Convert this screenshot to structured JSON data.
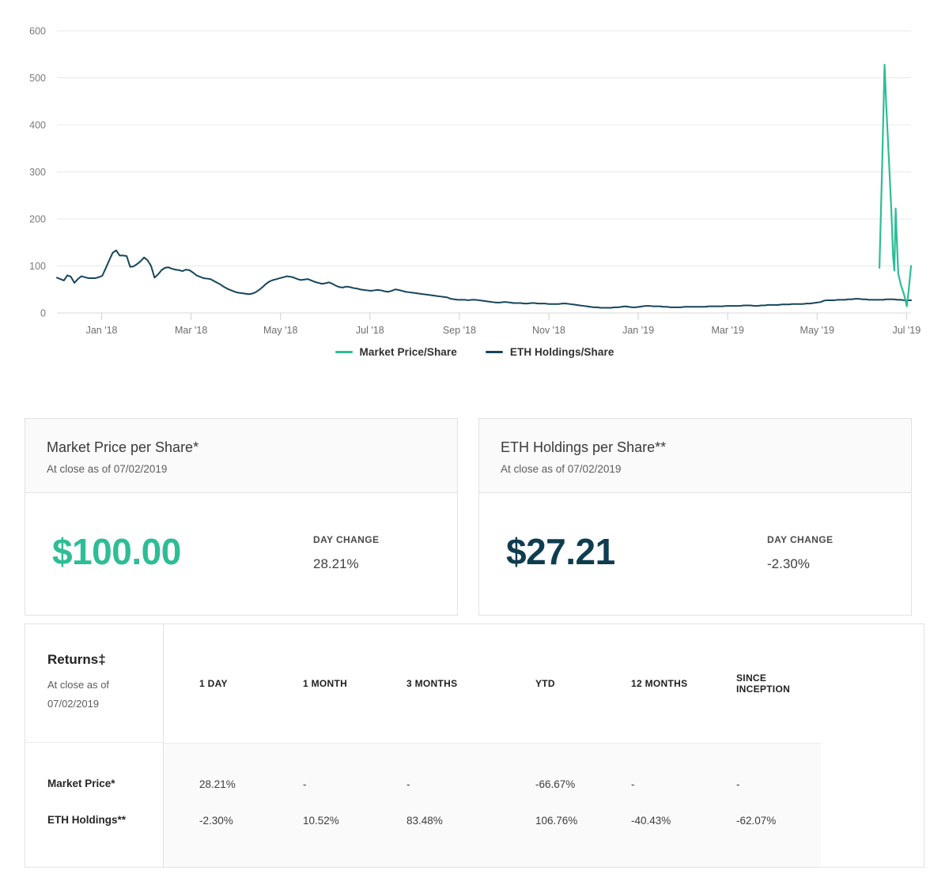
{
  "chart_data": {
    "type": "line",
    "title": "",
    "xlabel": "",
    "ylabel": "",
    "ylim": [
      0,
      600
    ],
    "yticks": [
      0,
      100,
      200,
      300,
      400,
      500,
      600
    ],
    "xtick_labels": [
      "Jan '18",
      "Mar '18",
      "May '18",
      "Jul '18",
      "Sep '18",
      "Nov '18",
      "Jan '19",
      "Mar '19",
      "May '19",
      "Jul '19"
    ],
    "grid": true,
    "legend_position": "bottom-center",
    "series": [
      {
        "name": "Market Price/Share",
        "color": "#2ebd96",
        "note": "Only trades near the end of the period; sharp spike to ~528 then decline to 100.",
        "points": [
          [
            0.963,
            96
          ],
          [
            0.966,
            300
          ],
          [
            0.969,
            528
          ],
          [
            0.971,
            440
          ],
          [
            0.974,
            330
          ],
          [
            0.977,
            215
          ],
          [
            0.979,
            120
          ],
          [
            0.9805,
            90
          ],
          [
            0.982,
            222
          ],
          [
            0.9835,
            150
          ],
          [
            0.985,
            84
          ],
          [
            0.988,
            60
          ],
          [
            0.992,
            38
          ],
          [
            0.995,
            14
          ],
          [
            0.997,
            44
          ],
          [
            1.0,
            100
          ]
        ]
      },
      {
        "name": "ETH Holdings/Share",
        "color": "#15455c",
        "note": "Full-period series from Dec 2017 to Jul 2019.",
        "values": [
          75,
          72,
          69,
          80,
          77,
          64,
          72,
          78,
          76,
          74,
          74,
          74,
          76,
          79,
          95,
          112,
          128,
          133,
          122,
          122,
          121,
          98,
          99,
          104,
          110,
          118,
          112,
          100,
          75,
          82,
          91,
          96,
          97,
          94,
          92,
          91,
          89,
          92,
          91,
          86,
          80,
          77,
          74,
          73,
          72,
          68,
          64,
          60,
          55,
          51,
          48,
          45,
          43,
          42,
          41,
          40,
          41,
          44,
          49,
          55,
          62,
          67,
          70,
          72,
          74,
          76,
          78,
          77,
          75,
          72,
          70,
          71,
          72,
          69,
          66,
          64,
          62,
          63,
          65,
          62,
          58,
          55,
          54,
          56,
          55,
          53,
          52,
          50,
          49,
          48,
          47,
          48,
          49,
          48,
          46,
          45,
          47,
          50,
          49,
          47,
          45,
          44,
          43,
          42,
          41,
          40,
          39,
          38,
          37,
          36,
          35,
          34,
          33,
          30,
          29,
          28,
          28,
          28,
          27,
          28,
          28,
          27,
          26,
          25,
          24,
          23,
          22,
          22,
          23,
          23,
          22,
          21,
          21,
          21,
          20,
          20,
          21,
          21,
          20,
          20,
          20,
          19,
          19,
          19,
          19,
          20,
          20,
          19,
          18,
          17,
          16,
          15,
          14,
          13,
          12,
          12,
          11,
          11,
          11,
          11,
          12,
          12,
          13,
          14,
          13,
          12,
          12,
          13,
          14,
          15,
          15,
          14,
          14,
          14,
          13,
          13,
          12,
          12,
          12,
          12,
          13,
          13,
          13,
          13,
          13,
          13,
          13,
          14,
          14,
          14,
          14,
          14,
          15,
          15,
          15,
          15,
          15,
          16,
          16,
          16,
          15,
          15,
          16,
          16,
          17,
          17,
          17,
          17,
          18,
          18,
          18,
          19,
          19,
          19,
          19,
          20,
          20,
          21,
          22,
          23,
          26,
          27,
          27,
          27,
          28,
          28,
          28,
          29,
          29,
          30,
          30,
          29,
          29,
          28,
          28,
          28,
          28,
          28,
          29,
          29,
          29,
          28,
          28,
          27,
          27,
          27
        ]
      }
    ],
    "legend": [
      {
        "label": "Market Price/Share",
        "color": "#2ebd96"
      },
      {
        "label": "ETH Holdings/Share",
        "color": "#15455c"
      }
    ]
  },
  "cards": [
    {
      "title": "Market Price per Share*",
      "subtitle": "At close as of 07/02/2019",
      "value": "$100.00",
      "value_color": "#2ebd96",
      "change_label": "DAY CHANGE",
      "change_value": "28.21%"
    },
    {
      "title": "ETH Holdings per Share**",
      "subtitle": "At close as of 07/02/2019",
      "value": "$27.21",
      "value_color": "#0f3d50",
      "change_label": "DAY CHANGE",
      "change_value": "-2.30%"
    }
  ],
  "returns": {
    "title": "Returns‡",
    "subtitle_line1": "At close as of",
    "subtitle_line2": "07/02/2019",
    "columns": [
      "1 DAY",
      "1 MONTH",
      "3 MONTHS",
      "YTD",
      "12 MONTHS",
      "SINCE INCEPTION"
    ],
    "rows": [
      {
        "label": "Market Price*",
        "values": [
          "28.21%",
          "-",
          "-",
          "-66.67%",
          "-",
          "-"
        ]
      },
      {
        "label": "ETH Holdings**",
        "values": [
          "-2.30%",
          "10.52%",
          "83.48%",
          "106.76%",
          "-40.43%",
          "-62.07%"
        ]
      }
    ]
  }
}
